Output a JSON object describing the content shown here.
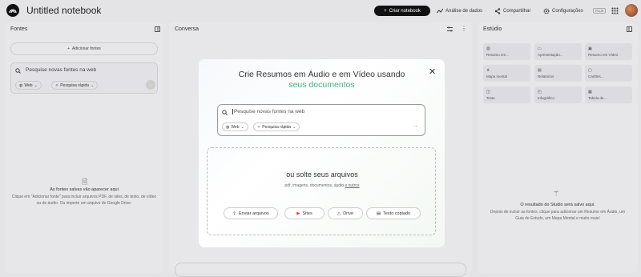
{
  "header": {
    "title": "Untitled notebook",
    "create_label": "Criar notebook",
    "analytics_label": "Análise de dados",
    "share_label": "Compartilhar",
    "settings_label": "Configurações",
    "plan_badge": "PLUS"
  },
  "sources": {
    "title": "Fontes",
    "add_label": "Adicionar fontes",
    "search_placeholder": "Pesquise novas fontes na web",
    "web_chip": "Web",
    "mode_chip": "Pesquisa rápida",
    "empty_title": "As fontes salvas vão aparecer aqui",
    "empty_body": "Clique em \"Adicionar fonte\" para incluir arquivos PDF, de sites, de texto, de vídeo ou de áudio. Ou importe um arquivo do Google Drive."
  },
  "chat": {
    "title": "Conversa"
  },
  "studio": {
    "title": "Estúdio",
    "tiles": [
      "Resumo em...",
      "Apresentação...",
      "Resumo em Vídeo",
      "Mapa mental",
      "Relatórios",
      "Cartões...",
      "Teste",
      "Infográfico",
      "Tabela de..."
    ],
    "empty_title": "O resultado do Studio será salvo aqui.",
    "empty_body": "Depois de incluir as fontes, clique para adicionar um Resumo em Áudio, um Guia de Estudo, um Mapa Mental e muito mais!"
  },
  "modal": {
    "title_line1": "Crie Resumos em Áudio e em Vídeo usando",
    "title_line2": "seus documentos",
    "search_placeholder": "Pesquise novas fontes na web",
    "web_chip": "Web",
    "mode_chip": "Pesquisa rápida",
    "drop_title": "ou solte seus arquivos",
    "drop_sub": "pdf, imagens, documentos, áudio",
    "drop_sub_link": "e outros",
    "buttons": {
      "upload": "Enviar arquivos",
      "sites": "Sites",
      "drive": "Drive",
      "text": "Texto copiado"
    }
  },
  "colors": {
    "accent_green": "#4caf7a",
    "dark_button": "#111111"
  }
}
